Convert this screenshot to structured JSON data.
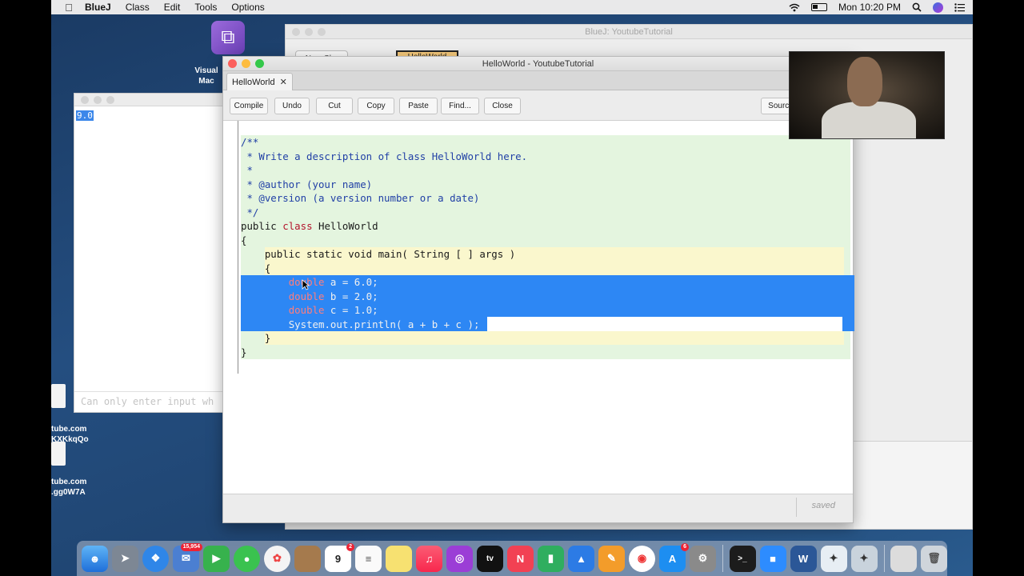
{
  "menubar": {
    "app_name": "BlueJ",
    "items": [
      "Class",
      "Edit",
      "Tools",
      "Options"
    ],
    "clock": "Mon 10:20 PM"
  },
  "desktop": {
    "vs_label_line1": "Visual",
    "vs_label_line2": "Mac",
    "file1_line1": "tube.com",
    "file1_line2": "KXKkqQo",
    "file2_line1": "tube.com",
    "file2_line2": ".gg0W7A"
  },
  "terminal": {
    "output": "9.0",
    "input_placeholder": "Can only enter input wh"
  },
  "bluej_window": {
    "title": "BlueJ:  YoutubeTutorial",
    "new_class_label": "New Cl...",
    "class_box_label": "HelloWorld"
  },
  "editor": {
    "title": "HelloWorld - YoutubeTutorial",
    "tab_label": "HelloWorld",
    "buttons": {
      "compile": "Compile",
      "undo": "Undo",
      "cut": "Cut",
      "copy": "Copy",
      "paste": "Paste",
      "find": "Find...",
      "close": "Close",
      "source": "Source"
    },
    "code": {
      "c1": "/**",
      "c2": " * Write a description of class HelloWorld here.",
      "c3": " *",
      "c4": " * @author (your name)",
      "c5": " * @version (a version number or a date)",
      "c6": " */",
      "l7_kw1": "public",
      "l7_kw2": "class",
      "l7_name": "HelloWorld",
      "l8": "{",
      "l9": "    public static void main( String [ ] args )",
      "l10": "    {",
      "l11_kw": "double",
      "l11_rest": " a = 6.0;",
      "l12_kw": "double",
      "l12_rest": " b = 2.0;",
      "l13_kw": "double",
      "l13_rest": " c = 1.0;",
      "l14": "System.out.println( a + b + c );",
      "l15": "    }",
      "l16": "}"
    },
    "status": "saved"
  },
  "dock": {
    "apps": [
      "Finder",
      "Launchpad",
      "Safari",
      "Mail",
      "FaceTime",
      "Messages",
      "Photos",
      "Notes",
      "Calendar",
      "Reminders",
      "Stickies",
      "Music",
      "Podcasts",
      "TV",
      "News",
      "Numbers",
      "Keynote",
      "Pages",
      "Chrome",
      "App Store",
      "System Preferences",
      "Terminal",
      "Zoom",
      "Word",
      "BlueJ",
      "BlueJ Projects",
      "Downloads",
      "Trash"
    ],
    "calendar_day": "9",
    "mail_badge": "15,954",
    "appstore_badge": "6",
    "calendar_badge": "2"
  }
}
